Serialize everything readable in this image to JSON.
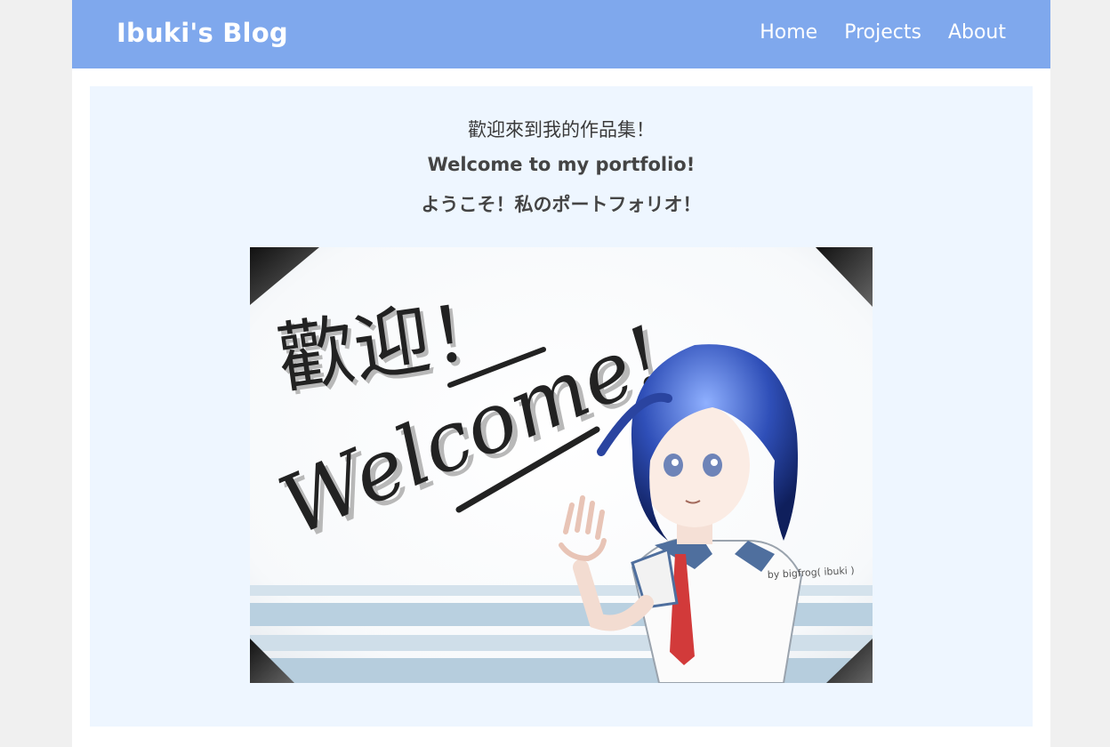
{
  "header": {
    "brand": "Ibuki's Blog",
    "nav": [
      {
        "label": "Home"
      },
      {
        "label": "Projects"
      },
      {
        "label": "About"
      }
    ],
    "background_color": "#7fa8ed"
  },
  "main": {
    "greeting_zh": "歡迎來到我的作品集！",
    "greeting_en": "Welcome to my portfolio!",
    "greeting_ja": "ようこそ！私のポートフォリオ！",
    "background_color": "#eef6ff",
    "artwork": {
      "handwritten_zh": "歡迎！",
      "handwritten_en": "Welcome!",
      "signature": "by bigfrog( ibuki )",
      "description": ""
    }
  }
}
